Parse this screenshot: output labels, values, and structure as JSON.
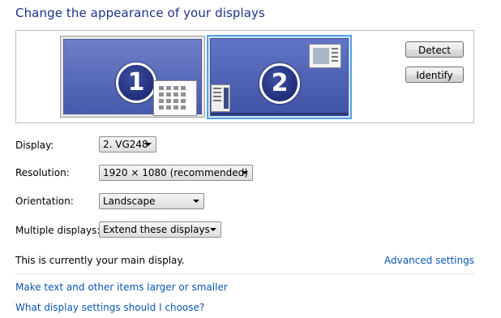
{
  "title": "Change the appearance of your displays",
  "monitors": [
    {
      "number": "1",
      "selected": false
    },
    {
      "number": "2",
      "selected": true
    }
  ],
  "buttons": {
    "detect": "Detect",
    "identify": "Identify"
  },
  "fields": {
    "display": {
      "label": "Display:",
      "value": "2. VG248"
    },
    "resolution": {
      "label": "Resolution:",
      "value": "1920 × 1080 (recommended)"
    },
    "orientation": {
      "label": "Orientation:",
      "value": "Landscape"
    },
    "multiple": {
      "label": "Multiple displays:",
      "value": "Extend these displays"
    }
  },
  "status": "This is currently your main display.",
  "links": {
    "advanced": "Advanced settings",
    "larger": "Make text and other items larger or smaller",
    "choose": "What display settings should I choose?"
  },
  "colors": {
    "title": "#1e3287",
    "link": "#0b56b5",
    "selection": "#56a1e2"
  }
}
